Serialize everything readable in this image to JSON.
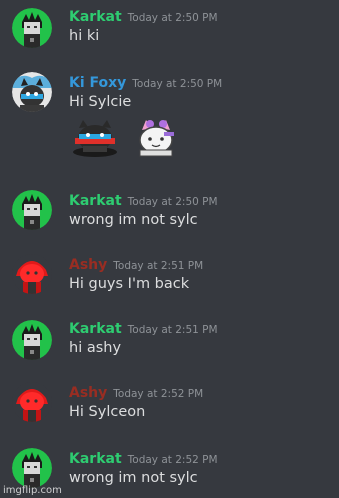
{
  "colors": {
    "background": "#36393f",
    "karkat": "#2ecc71",
    "kifoxy": "#3498db",
    "ashy": "#992d22",
    "timestamp": "#8e9297",
    "message_text": "#dcddde"
  },
  "messages": [
    {
      "author": "Karkat",
      "time": "Today at 2:50 PM",
      "text": "hi ki",
      "avatar": "karkat-avatar"
    },
    {
      "author": "Ki Foxy",
      "time": "Today at 2:50 PM",
      "text": "Hi Sylcie",
      "avatar": "kifoxy-avatar",
      "stickers": [
        "black-cat-sticker",
        "sylveon-sticker"
      ]
    },
    {
      "author": "Karkat",
      "time": "Today at 2:50 PM",
      "text": "wrong im not sylc",
      "avatar": "karkat-avatar"
    },
    {
      "author": "Ashy",
      "time": "Today at 2:51 PM",
      "text": "Hi guys I'm back",
      "avatar": "ashy-avatar"
    },
    {
      "author": "Karkat",
      "time": "Today at 2:51 PM",
      "text": "hi ashy",
      "avatar": "karkat-avatar"
    },
    {
      "author": "Ashy",
      "time": "Today at 2:52 PM",
      "text": "Hi Sylceon",
      "avatar": "ashy-avatar"
    },
    {
      "author": "Karkat",
      "time": "Today at 2:52 PM",
      "text": "wrong im not sylc",
      "avatar": "karkat-avatar"
    }
  ],
  "watermark": "imgflip.com"
}
